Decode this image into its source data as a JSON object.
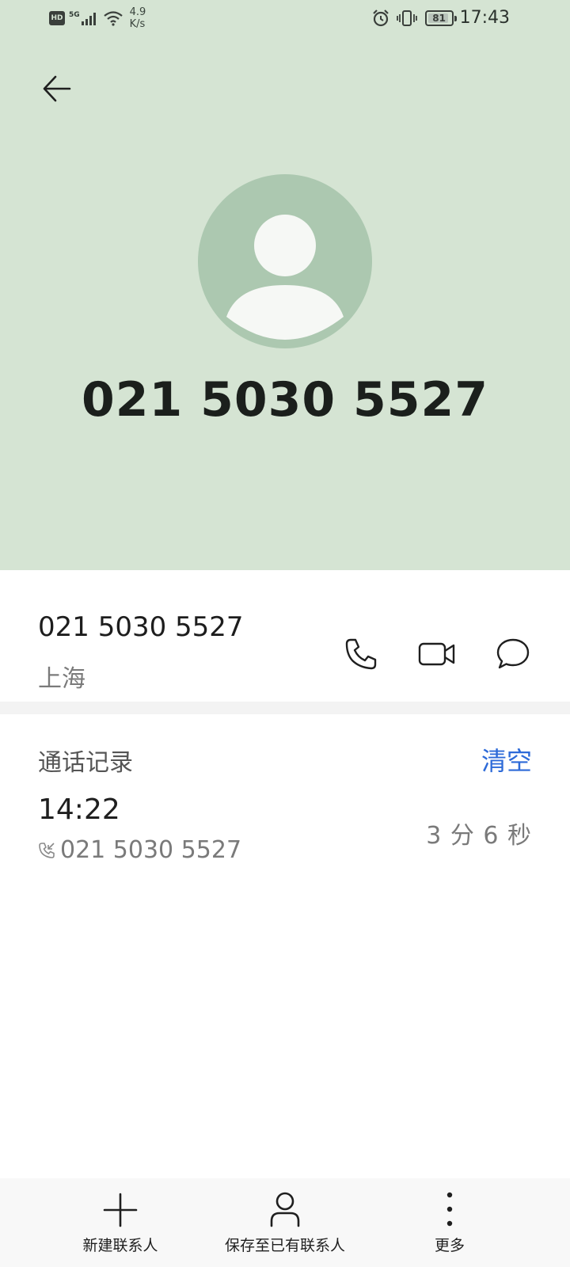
{
  "status_bar": {
    "hd": "HD",
    "network": "5G",
    "speed_value": "4.9",
    "speed_unit": "K/s",
    "battery": "81",
    "time": "17:43"
  },
  "contact": {
    "display_number": "021 5030 5527",
    "number": "021 5030 5527",
    "location": "上海"
  },
  "call_log": {
    "title": "通话记录",
    "clear_label": "清空",
    "entries": [
      {
        "time": "14:22",
        "number": "021 5030 5527",
        "duration": "3 分 6 秒"
      }
    ]
  },
  "bottom_bar": {
    "new_contact": "新建联系人",
    "save_existing": "保存至已有联系人",
    "more": "更多"
  },
  "colors": {
    "header_bg": "#d5e4d3",
    "avatar_bg": "#acc8b0",
    "accent": "#2d6ad8"
  }
}
